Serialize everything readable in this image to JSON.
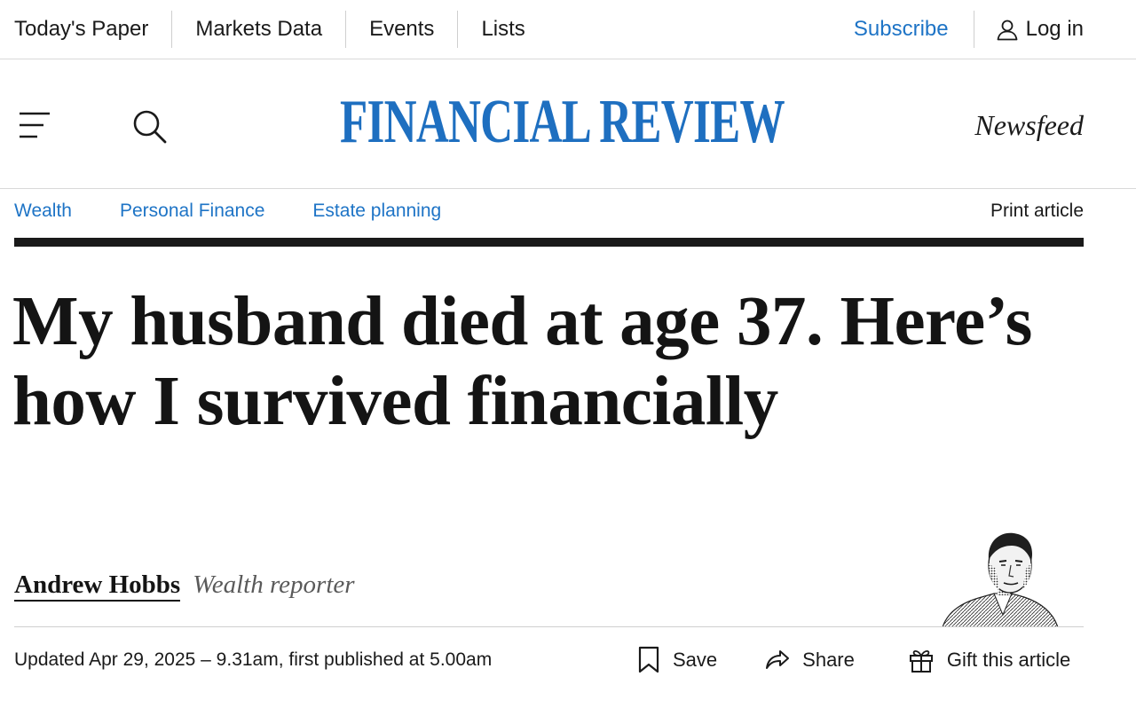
{
  "topnav": {
    "items": [
      "Today's Paper",
      "Markets Data",
      "Events",
      "Lists"
    ],
    "subscribe": "Subscribe",
    "login": "Log in"
  },
  "masthead": {
    "logo": "FINANCIAL REVIEW",
    "newsfeed": "Newsfeed"
  },
  "section_nav": {
    "crumbs": [
      "Wealth",
      "Personal Finance",
      "Estate planning"
    ],
    "print": "Print article"
  },
  "article": {
    "headline": "My husband died at age 37. Here’s how I survived financially",
    "author": "Andrew Hobbs",
    "role": "Wealth reporter",
    "updated": "Updated Apr 29, 2025 – 9.31am, first published at 5.00am"
  },
  "actions": {
    "save": "Save",
    "share": "Share",
    "gift": "Gift this article"
  },
  "colors": {
    "brand_blue": "#1e6fc0",
    "link_blue": "#1e74c6"
  },
  "icons": [
    "user-icon",
    "menu-icon",
    "search-icon",
    "bookmark-icon",
    "share-icon",
    "gift-icon"
  ]
}
